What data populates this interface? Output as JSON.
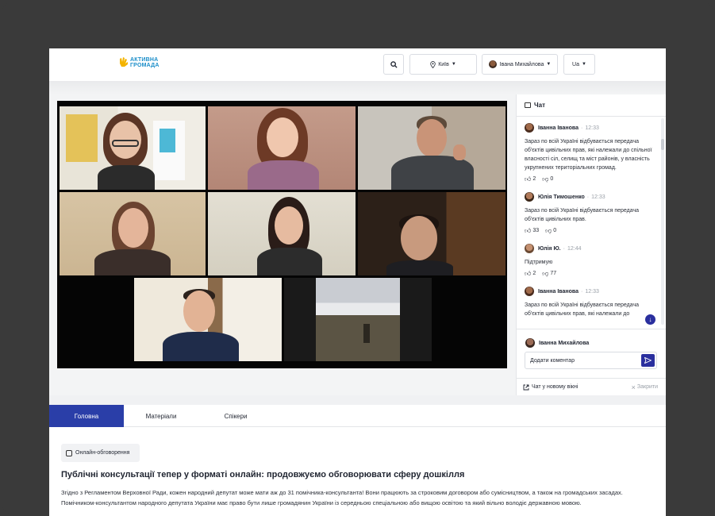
{
  "header": {
    "logo_line1": "АКТИВНА",
    "logo_line2": "ГРОМАДА",
    "city": "Київ",
    "user": "Івана Михайлова",
    "language": "Ua"
  },
  "colors": {
    "accent": "#2a3ea8",
    "logo_blue": "#1b8ec9",
    "logo_yellow": "#f4b400",
    "active_speaker": "#d9e37a"
  },
  "chat": {
    "title": "Чат",
    "messages": [
      {
        "name": "Іванна Іванова",
        "time": "12:33",
        "text": "Зараз по всій Україні відбувається передача об'єктів цивільних прав, які належали до спільної власності сіл, селищ та міст районів, у власність укрупнених територіальних громад.",
        "likes": "2",
        "dislikes": "0"
      },
      {
        "name": "Юлія Тимошенко",
        "time": "12:33",
        "text": "Зараз по всій Україні відбувається передача об'єктів цивільних прав.",
        "likes": "33",
        "dislikes": "0"
      },
      {
        "name": "Юлія Ю.",
        "time": "12:44",
        "text": "Підтримую",
        "likes": "2",
        "dislikes": "77"
      },
      {
        "name": "Іванна Іванова",
        "time": "12:33",
        "text": "Зараз по всій Україні відбувається передача об'єктів цивільних прав, які належали до",
        "likes": "",
        "dislikes": ""
      }
    ],
    "current_user": "Іванна Михайлова",
    "comment_placeholder": "Додати коментар",
    "open_new_window": "Чат у новому вікні",
    "close": "Закрити"
  },
  "tabs": [
    "Головна",
    "Матеріали",
    "Спікери"
  ],
  "article": {
    "tag": "Онлайн-обговорення",
    "title": "Публічні консультації тепер у форматі онлайн: продовжуємо обговорювати сферу дошкілля",
    "body": "Згідно з Регламентом Верховної Ради, кожен народний депутат може мати аж до 31 помічника-консультанта! Вони працюють за строковим договором або сумісництвом, а також на громадських засадах. Помічником-консультантом народного депутата України має право бути лише громадянин України із середньою спеціальною або вищою освітою та який вільно володіє державною мовою."
  }
}
